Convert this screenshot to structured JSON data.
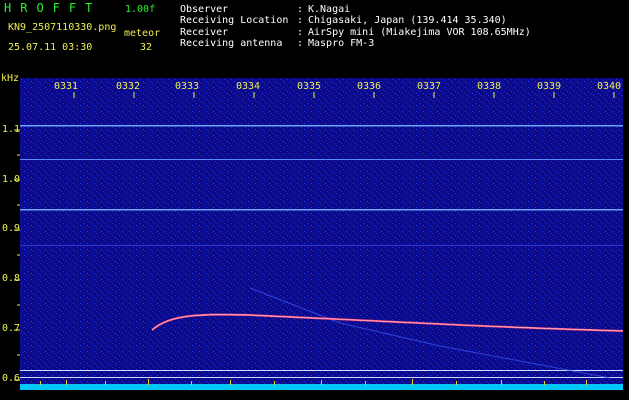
{
  "header": {
    "title": "HROFFT",
    "version": "1.00f",
    "filename": "KN9_2507110330.png",
    "datetime": "25.07.11 03:30",
    "meteor_label": "meteor",
    "meteor_count": "32",
    "fields": [
      {
        "label": "Observer",
        "sep": ":",
        "value": "K.Nagai"
      },
      {
        "label": "Receiving Location",
        "sep": ":",
        "value": "Chigasaki, Japan (139.414 35.340)"
      },
      {
        "label": "Receiver",
        "sep": ":",
        "value": "AirSpy mini (Miakejima VOR 108.65MHz)"
      },
      {
        "label": "Receiving antenna",
        "sep": ":",
        "value": "Maspro FM-3"
      }
    ]
  },
  "y_axis": {
    "unit": "kHz",
    "ticks": [
      "1.1",
      "1.0",
      "0.9",
      "0.8",
      "0.7",
      "0.6"
    ]
  },
  "x_axis": {
    "ticks": [
      "0331",
      "0332",
      "0333",
      "0334",
      "0335",
      "0336",
      "0337",
      "0338",
      "0339",
      "0340"
    ]
  },
  "colors": {
    "background": "#0a0a8a",
    "text_green": "#28f028",
    "text_yellow": "#f0f050",
    "noise_floor": "#00c8ff"
  }
}
